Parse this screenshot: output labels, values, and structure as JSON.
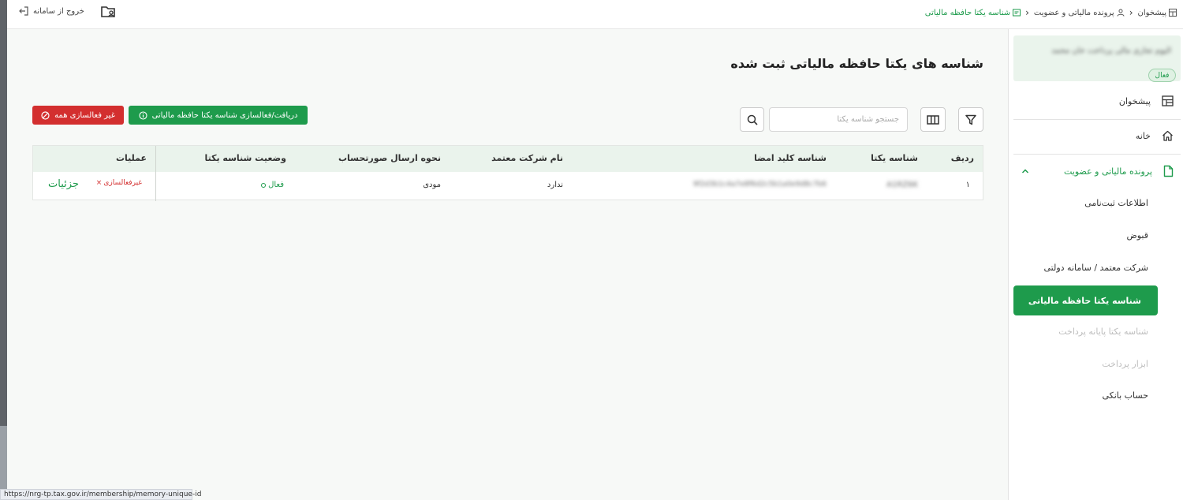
{
  "topbar": {
    "logout_label": "خروج از سامانه",
    "breadcrumb": [
      "پیشخوان",
      "پرونده مالیاتی و عضویت",
      "شناسه یکتا حافظه مالیاتی"
    ]
  },
  "page": {
    "title": "شناسه های یکتا حافظه مالیاتی ثبت شده"
  },
  "toolbar": {
    "deactivate_all_label": "غیر فعالسازی همه",
    "activate_label": "دریافت/فعالسازی شناسه یکتا حافظه مالیاتی",
    "search_placeholder": "جستجو شناسه یکتا"
  },
  "table": {
    "headers": {
      "row": "ردیف",
      "unique_id": "شناسه یکتا",
      "signature_key": "شناسه کلید امضا",
      "company": "نام شرکت معتمد",
      "send_method": "نحوه ارسال صورتحساب",
      "status": "وضعیت شناسه یکتا",
      "actions": "عملیات"
    },
    "rows": [
      {
        "row": "۱",
        "unique_id": "A1RZ6K",
        "signature_key": "9f2d3b1c4a7e8f6d2c5b1a0e9d8c7b6",
        "company": "ندارد",
        "send_method": "مودی",
        "status": "فعال",
        "deactivate": "غیرفعالسازی",
        "details": "جزئیات"
      }
    ]
  },
  "sidebar": {
    "profile_name": "الیوم تجاری مالی پرداخت خان محمد",
    "profile_badge": "فعال",
    "nav": {
      "dashboard": "پیشخوان",
      "home": "خانه",
      "tax_file": "پرونده مالیاتی و عضویت"
    },
    "sub_items": [
      "اطلاعات ثبت‌نامی",
      "قبوض",
      "شرکت معتمد / سامانه دولتی",
      "شناسه یکتا حافظه مالیاتی",
      "شناسه یکتا پایانه پرداخت",
      "ابزار پرداخت",
      "حساب بانکی"
    ]
  },
  "statusbar": {
    "url": "https://nrg-tp.tax.gov.ir/membership/memory-unique-id"
  },
  "colors": {
    "primary_green": "#1e9b4c",
    "danger_red": "#d32f2f",
    "header_bg": "#eaf3ec"
  }
}
